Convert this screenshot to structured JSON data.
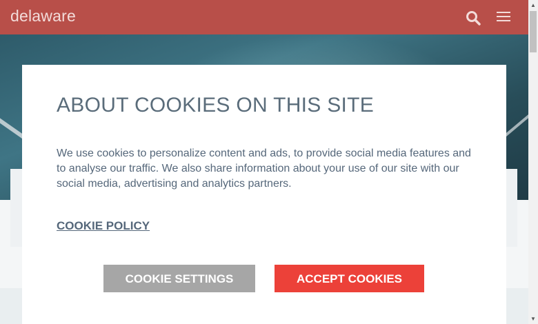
{
  "header": {
    "logo_text": "delaware",
    "search_icon": "search-icon",
    "menu_icon": "hamburger-menu-icon",
    "background_color": "#b84f49"
  },
  "cookie_modal": {
    "title": "ABOUT COOKIES ON THIS SITE",
    "body": "We use cookies to personalize content and ads, to provide social media features and to analyse our traffic. We also share information about your use of our site with our social media, advertising and analytics partners.",
    "policy_link": "COOKIE POLICY",
    "settings_button": "COOKIE SETTINGS",
    "accept_button": "ACCEPT COOKIES",
    "accept_color": "#ec4139",
    "settings_color": "#a6a6a6"
  },
  "scrollbar": {
    "up_icon": "scroll-up-arrow-icon",
    "down_icon": "scroll-down-arrow-icon"
  }
}
